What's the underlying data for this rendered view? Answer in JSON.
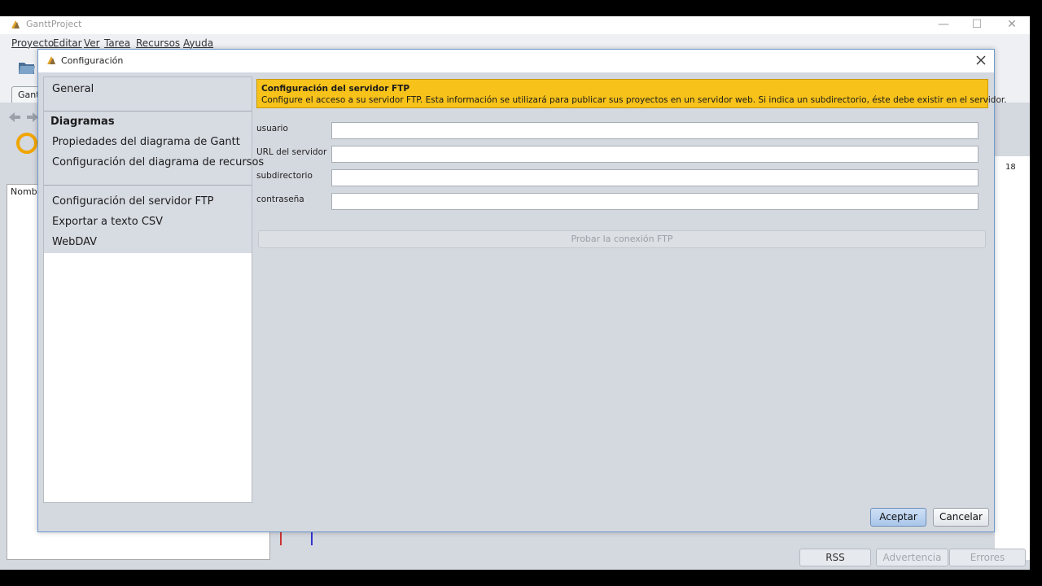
{
  "main_window": {
    "title": "GanttProject",
    "menu": [
      "Proyecto",
      "Editar",
      "Ver",
      "Tarea",
      "Recursos",
      "Ayuda"
    ],
    "tab_label": "Gant",
    "column_header": "Nombr",
    "timeline_label": "18"
  },
  "status_bar": {
    "rss": "RSS",
    "warning": "Advertencia",
    "errors": "Errores"
  },
  "dialog": {
    "title": "Configuración",
    "nav": {
      "general": "General",
      "section_header": "Diagramas",
      "gantt_props": "Propiedades del diagrama de Gantt",
      "resource_config": "Configuración del diagrama de recursos",
      "ftp_config": "Configuración del servidor FTP",
      "csv_export": "Exportar a texto CSV",
      "webdav": "WebDAV"
    },
    "banner": {
      "title": "Configuración del servidor FTP",
      "description": "Configure el acceso a su servidor FTP. Esta información se utilizará para publicar sus proyectos en un servidor web. Si indica un subdirectorio, éste debe existir en el servidor."
    },
    "fields": {
      "user_label": "usuario",
      "user_value": "",
      "server_label": "URL del servidor",
      "server_value": "",
      "subdir_label": "subdirectorio",
      "subdir_value": "",
      "password_label": "contraseña",
      "password_value": ""
    },
    "test_button": "Probar la conexión FTP",
    "ok_button": "Aceptar",
    "cancel_button": "Cancelar"
  },
  "colors": {
    "banner": "#f7c21a",
    "ok_button": "#b9d2ef",
    "dialog_border": "#6f9ad0"
  }
}
